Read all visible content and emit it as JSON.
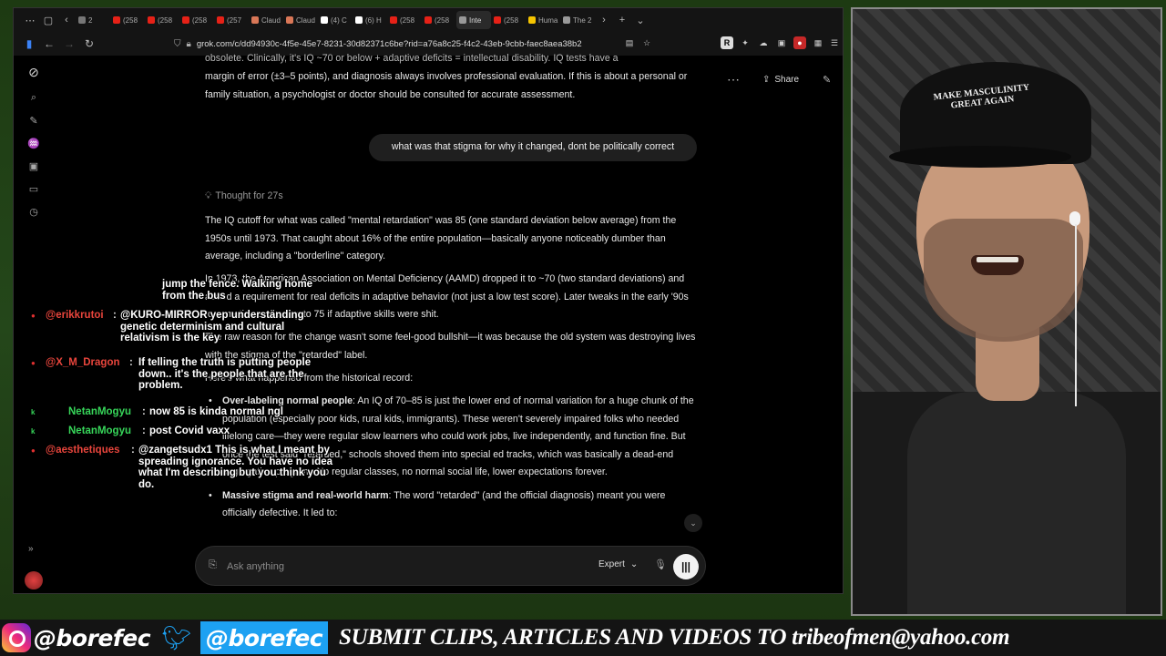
{
  "browser": {
    "tabs": [
      {
        "label": "2",
        "color": "#777"
      },
      {
        "label": "(258",
        "color": "#e62117"
      },
      {
        "label": "(258",
        "color": "#e62117"
      },
      {
        "label": "(258",
        "color": "#e62117"
      },
      {
        "label": "(257",
        "color": "#e62117"
      },
      {
        "label": "Claud",
        "color": "#d97757"
      },
      {
        "label": "Claud",
        "color": "#d97757"
      },
      {
        "label": "(4) C",
        "color": "#ffffff"
      },
      {
        "label": "(6) H",
        "color": "#ffffff"
      },
      {
        "label": "(258",
        "color": "#e62117"
      },
      {
        "label": "(258",
        "color": "#e62117"
      },
      {
        "label": "Inte",
        "color": "#999999"
      },
      {
        "label": "(258",
        "color": "#e62117"
      },
      {
        "label": "Huma",
        "color": "#f5c400"
      },
      {
        "label": "The 2",
        "color": "#999999"
      }
    ],
    "url": "grok.com/c/dd94930c-4f5e-45e7-8231-30d82371c6be?rid=a76a8c25-f4c2-43eb-9cbb-faec8aea38b2"
  },
  "app": {
    "share_label": "Share",
    "top_text": "obsolete. Clinically, it's IQ ~70 or below + adaptive deficits = intellectual disability. IQ tests have a",
    "para0": "margin of error (±3–5 points), and diagnosis always involves professional evaluation. If this is about a personal or family situation, a psychologist or doctor should be consulted for accurate assessment.",
    "user_message": "what was that stigma for why it changed, dont be politically correct",
    "thought_label": "Thought for 27s",
    "para1": "The IQ cutoff for what was called \"mental retardation\" was 85 (one standard deviation below average) from the 1950s until 1973. That caught about 16% of the entire population—basically anyone noticeably dumber than average, including a \"borderline\" category.",
    "para2": "In 1973, the American Association on Mental Deficiency (AAMD) dropped it to ~70 (two standard deviations) and added a requirement for real deficits in adaptive behavior (not just a low test score). Later tweaks in the early '90s to sometimes allow up to 75 if adaptive skills were shit.",
    "para3": "The raw reason for the change wasn't some feel-good bullshit—it was because the old system was destroying lives with the stigma of the \"retarded\" label.",
    "para4": "Here's what happened from the historical record:",
    "bullet1_title": "Over-labeling normal people",
    "bullet1_text": ": An IQ of 70–85 is just the lower end of normal variation for a huge chunk of the population (especially poor kids, rural kids, immigrants). These weren't severely impaired folks who needed lifelong care—they were regular slow learners who could work jobs, live independently, and function fine. But once the test said \"retarded,\" schools shoved them into special ed tracks, which was basically a dead-end segregation program. No regular classes, no normal social life, lower expectations forever.",
    "bullet2_title": "Massive stigma and real-world harm",
    "bullet2_text": ": The word \"retarded\" (and the official diagnosis) meant you were officially defective. It led to:",
    "input_placeholder": "Ask anything",
    "model_label": "Expert"
  },
  "stream_chat": [
    {
      "user": "",
      "text": "jump the fence. Walking home from the bus",
      "user_color": "#e8453c"
    },
    {
      "user": "@erikkrutoi",
      "text": "@KURO-MIRROR yep understanding genetic determinism and cultural relativism is the key",
      "user_color": "#e8453c"
    },
    {
      "user": "@X_M_Dragon",
      "text": "If telling the truth is putting people down.. it's the people that are the problem.",
      "user_color": "#e8453c"
    },
    {
      "user": "NetanMogyu",
      "text": "now 85 is kinda normal ngl",
      "user_color": "#37d65a"
    },
    {
      "user": "NetanMogyu",
      "text": "post Covid vaxx",
      "user_color": "#37d65a"
    },
    {
      "user": "@aesthetiques",
      "text": "@zangetsudx1 This is what I meant by spreading ignorance. You have no idea what I'm describing but you think you do.",
      "user_color": "#e8453c"
    }
  ],
  "webcam": {
    "cap_text": "MAKE MASCULINITY GREAT AGAIN"
  },
  "banner": {
    "ig_handle": "@borefec",
    "twitter_handle": "@borefec",
    "submit_text": "SUBMIT CLIPS, ARTICLES AND VIDEOS TO tribeofmen@yahoo.com"
  }
}
